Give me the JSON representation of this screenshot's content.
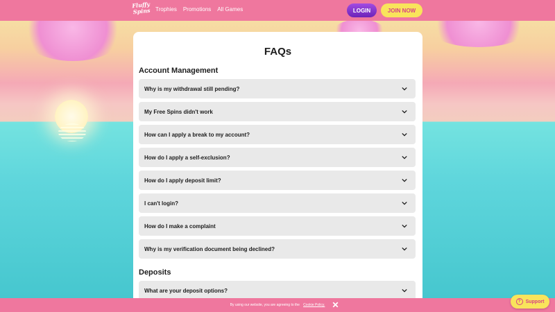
{
  "header": {
    "logo_text": "Fluffy Spins",
    "nav": [
      "Trophies",
      "Promotions",
      "All Games"
    ],
    "login_label": "LOGIN",
    "join_label": "JOIN NOW"
  },
  "page": {
    "title": "FAQs",
    "sections": [
      {
        "title": "Account Management",
        "questions": [
          "Why is my withdrawal still pending?",
          "My Free Spins didn't work",
          "How can I apply a break to my account?",
          "How do I apply a self-exclusion?",
          "How do I apply deposit limit?",
          "I can't login?",
          "How do I make a complaint",
          "Why is my verification document being declined?"
        ]
      },
      {
        "title": "Deposits",
        "questions": [
          "What are your deposit options?"
        ]
      }
    ]
  },
  "cookie_bar": {
    "message": "By using our website, you are agreeing to the",
    "link_label": "Cookie Policy."
  },
  "support": {
    "label": "Support"
  },
  "colors": {
    "header_bg": "#ef779e",
    "login_bg": "#7a2cc6",
    "join_bg": "#f9e45b",
    "faq_item_bg": "#e9e9e9"
  }
}
